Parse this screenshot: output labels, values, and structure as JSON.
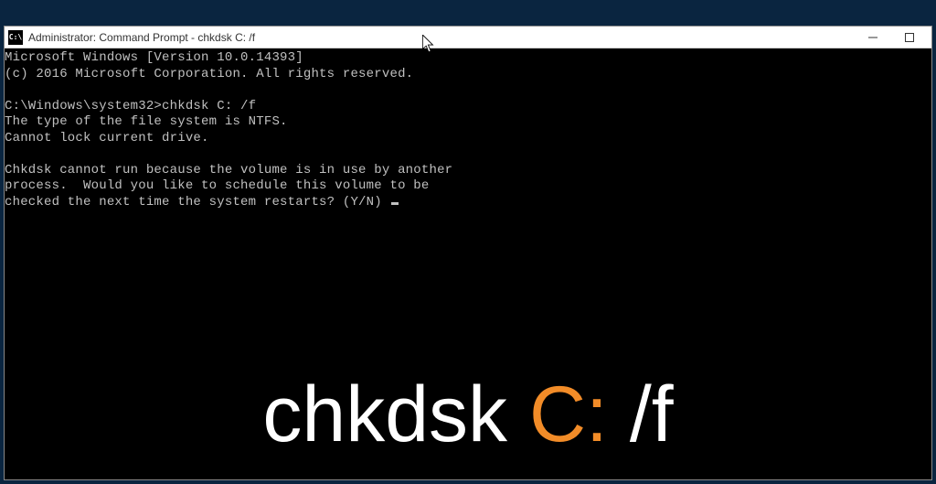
{
  "window": {
    "title": "Administrator: Command Prompt - chkdsk C: /f"
  },
  "console": {
    "line1": "Microsoft Windows [Version 10.0.14393]",
    "line2": "(c) 2016 Microsoft Corporation. All rights reserved.",
    "blank1": "",
    "prompt_line": "C:\\Windows\\system32>chkdsk C: /f",
    "line3": "The type of the file system is NTFS.",
    "line4": "Cannot lock current drive.",
    "blank2": "",
    "line5": "Chkdsk cannot run because the volume is in use by another",
    "line6": "process.  Would you like to schedule this volume to be",
    "line7": "checked the next time the system restarts? (Y/N) "
  },
  "overlay": {
    "part1": "chkdsk ",
    "part2": "C:",
    "part3": " /f"
  }
}
